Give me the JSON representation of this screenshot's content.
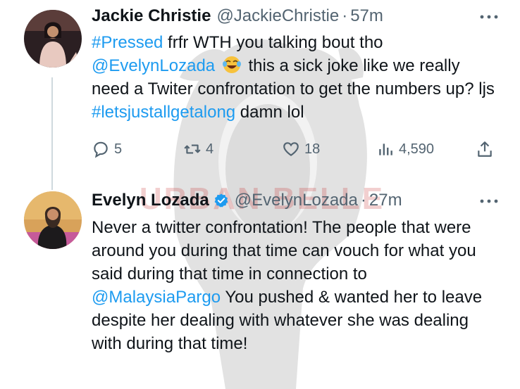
{
  "watermark": {
    "text": "URBAN BELLE"
  },
  "tweets": [
    {
      "name": "Jackie Christie",
      "handle": "@JackieChristie",
      "separator": "·",
      "time": "57m",
      "text": {
        "hashtag1": "#Pressed",
        "t1": " frfr WTH you talking bout tho ",
        "mention": "@EvelynLozada",
        "emoji": "😂",
        "t2": " this a sick joke like we really need a Twiter confrontation to get the numbers up? ljs ",
        "hashtag2": "#letsjustallgetalong",
        "t3": " damn lol"
      },
      "stats": {
        "replies": "5",
        "retweets": "4",
        "likes": "18",
        "views": "4,590"
      },
      "icons": {
        "reply": "comment-icon",
        "retweet": "retweet-icon",
        "like": "heart-icon",
        "views": "views-chart-icon",
        "share": "share-icon",
        "more": "more-icon"
      }
    },
    {
      "name": "Evelyn Lozada",
      "handle": "@EvelynLozada",
      "separator": "·",
      "time": "27m",
      "verified": true,
      "text": {
        "t1": "Never a twitter confrontation! The people that were around you during that time can vouch for what you said during that time in connection to ",
        "mention": "@MalaysiaPargo",
        "t2": " You pushed & wanted her to leave despite her dealing with whatever she was dealing with during that time!"
      }
    }
  ],
  "colors": {
    "link": "#1d9bf0",
    "muted": "#536471",
    "verified": "#1d9bf0"
  }
}
